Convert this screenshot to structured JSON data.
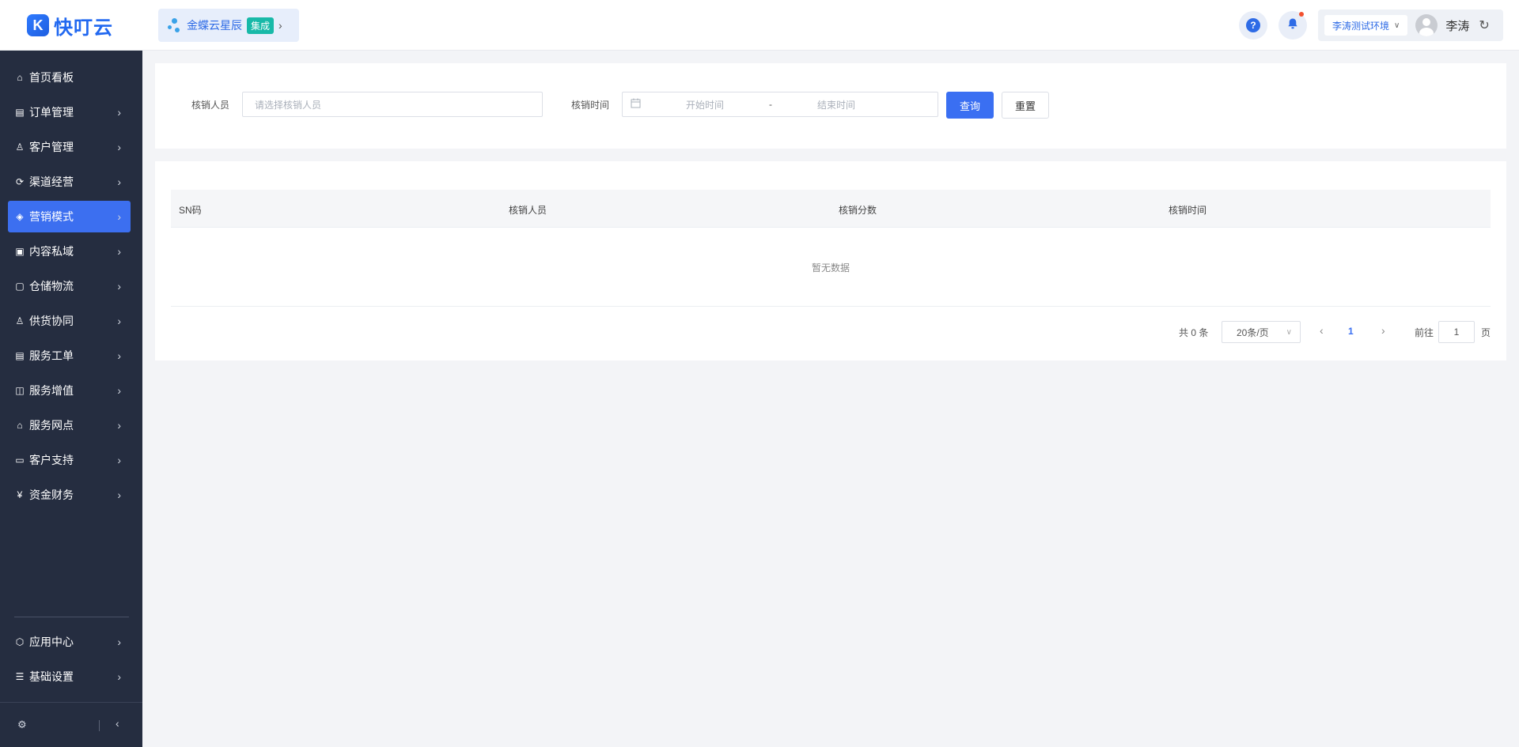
{
  "header": {
    "logo_mark": "K",
    "logo_text": "快叮云",
    "integration_name": "金蝶云星辰",
    "integration_tag": "集成",
    "env_label": "李涛测试环境",
    "username": "李涛"
  },
  "sidebar": {
    "items": [
      {
        "label": "首页看板",
        "icon": "home-icon",
        "glyph": "⌂"
      },
      {
        "label": "订单管理",
        "icon": "order-icon",
        "glyph": "▤"
      },
      {
        "label": "客户管理",
        "icon": "user-icon",
        "glyph": "♙"
      },
      {
        "label": "渠道经营",
        "icon": "channel-icon",
        "glyph": "⟳"
      },
      {
        "label": "营销模式",
        "icon": "tag-icon",
        "glyph": "◈"
      },
      {
        "label": "内容私域",
        "icon": "image-icon",
        "glyph": "▣"
      },
      {
        "label": "仓储物流",
        "icon": "box-icon",
        "glyph": "▢"
      },
      {
        "label": "供货协同",
        "icon": "supply-icon",
        "glyph": "♙"
      },
      {
        "label": "服务工单",
        "icon": "ticket-icon",
        "glyph": "▤"
      },
      {
        "label": "服务增值",
        "icon": "bag-icon",
        "glyph": "◫"
      },
      {
        "label": "服务网点",
        "icon": "store-icon",
        "glyph": "⌂"
      },
      {
        "label": "客户支持",
        "icon": "support-icon",
        "glyph": "▭"
      },
      {
        "label": "资金财务",
        "icon": "yuan-icon",
        "glyph": "¥"
      }
    ],
    "bottom_items": [
      {
        "label": "应用中心",
        "icon": "cube-icon",
        "glyph": "⬡"
      },
      {
        "label": "基础设置",
        "icon": "settings-icon",
        "glyph": "☰"
      }
    ],
    "active_index": 4
  },
  "filters": {
    "operator_label": "核销人员",
    "operator_placeholder": "请选择核销人员",
    "time_label": "核销时间",
    "start_placeholder": "开始时间",
    "range_sep": "-",
    "end_placeholder": "结束时间",
    "query_button": "查询",
    "reset_button": "重置"
  },
  "table": {
    "columns": [
      "SN码",
      "核销人员",
      "核销分数",
      "核销时间"
    ],
    "rows": [],
    "empty_text": "暂无数据"
  },
  "pagination": {
    "total_text": "共 0 条",
    "page_size": "20条/页",
    "current_page": "1",
    "goto_label": "前往",
    "goto_value": "1",
    "page_unit": "页"
  }
}
